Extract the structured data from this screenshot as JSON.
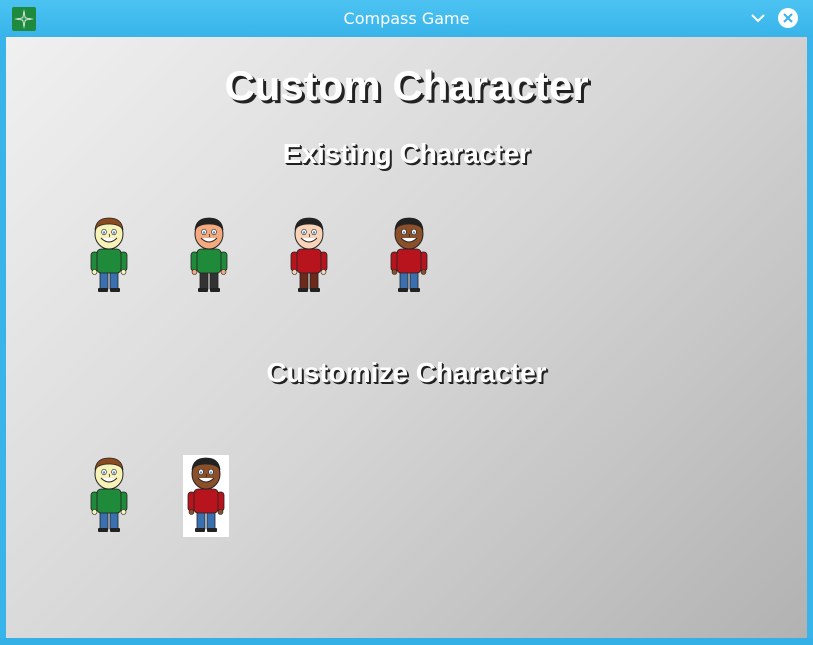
{
  "window": {
    "title": "Compass Game",
    "app_icon": "compass-star-icon",
    "controls": [
      "minimize-chevron-icon",
      "close-circle-icon"
    ]
  },
  "page": {
    "title": "Custom Character",
    "existing_heading": "Existing Character",
    "customize_heading": "Customize Character"
  },
  "existing_characters": [
    {
      "skin": "#f7f2b8",
      "hair": "#8a4a22",
      "shirt": "#1e8a3a",
      "pants": "#3a6fb0"
    },
    {
      "skin": "#f4a97e",
      "hair": "#222222",
      "shirt": "#1e8a3a",
      "pants": "#333333"
    },
    {
      "skin": "#f8d3b8",
      "hair": "#222222",
      "shirt": "#b8141e",
      "pants": "#6b2a1a"
    },
    {
      "skin": "#8b4f2a",
      "hair": "#222222",
      "shirt": "#b8141e",
      "pants": "#3a6fb0"
    }
  ],
  "custom_characters": [
    {
      "skin": "#f7f2b8",
      "hair": "#8a4a22",
      "shirt": "#1e8a3a",
      "pants": "#3a6fb0",
      "selected": false
    },
    {
      "skin": "#8b4f2a",
      "hair": "#222222",
      "shirt": "#b8141e",
      "pants": "#3a6fb0",
      "selected": true
    }
  ]
}
